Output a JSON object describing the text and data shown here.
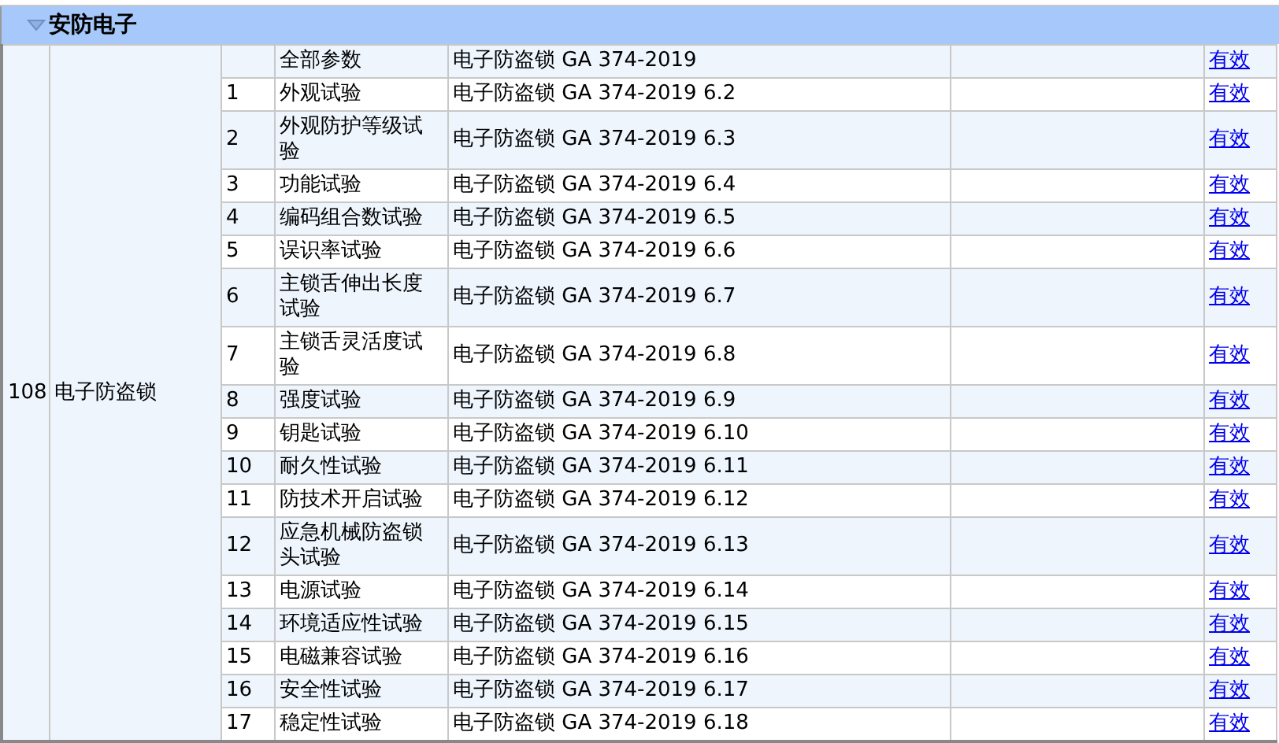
{
  "group": {
    "title": "安防电子",
    "expanded": true
  },
  "product": {
    "number": "108",
    "name": "电子防盗锁"
  },
  "rows": [
    {
      "item": "全部参数",
      "standard": "电子防盗锁 GA 374-2019",
      "status": "有效"
    },
    {
      "no": "1",
      "item": "外观试验",
      "standard": "电子防盗锁 GA 374-2019 6.2",
      "status": "有效"
    },
    {
      "no": "2",
      "item": "外观防护等级试验",
      "standard": "电子防盗锁 GA 374-2019 6.3",
      "status": "有效"
    },
    {
      "no": "3",
      "item": "功能试验",
      "standard": "电子防盗锁 GA 374-2019 6.4",
      "status": "有效"
    },
    {
      "no": "4",
      "item": "编码组合数试验",
      "standard": "电子防盗锁 GA 374-2019 6.5",
      "status": "有效"
    },
    {
      "no": "5",
      "item": "误识率试验",
      "standard": "电子防盗锁 GA 374-2019 6.6",
      "status": "有效"
    },
    {
      "no": "6",
      "item": "主锁舌伸出长度试验",
      "standard": "电子防盗锁 GA 374-2019 6.7",
      "status": "有效"
    },
    {
      "no": "7",
      "item": "主锁舌灵活度试验",
      "standard": "电子防盗锁 GA 374-2019 6.8",
      "status": "有效"
    },
    {
      "no": "8",
      "item": "强度试验",
      "standard": "电子防盗锁 GA 374-2019 6.9",
      "status": "有效"
    },
    {
      "no": "9",
      "item": "钥匙试验",
      "standard": "电子防盗锁 GA 374-2019 6.10",
      "status": "有效"
    },
    {
      "no": "10",
      "item": "耐久性试验",
      "standard": "电子防盗锁 GA 374-2019 6.11",
      "status": "有效"
    },
    {
      "no": "11",
      "item": "防技术开启试验",
      "standard": "电子防盗锁 GA 374-2019 6.12",
      "status": "有效"
    },
    {
      "no": "12",
      "item": "应急机械防盗锁头试验",
      "standard": "电子防盗锁 GA 374-2019 6.13",
      "status": "有效"
    },
    {
      "no": "13",
      "item": "电源试验",
      "standard": "电子防盗锁 GA 374-2019 6.14",
      "status": "有效"
    },
    {
      "no": "14",
      "item": "环境适应性试验",
      "standard": "电子防盗锁 GA 374-2019 6.15",
      "status": "有效"
    },
    {
      "no": "15",
      "item": "电磁兼容试验",
      "standard": "电子防盗锁 GA 374-2019 6.16",
      "status": "有效"
    },
    {
      "no": "16",
      "item": "安全性试验",
      "standard": "电子防盗锁 GA 374-2019 6.17",
      "status": "有效"
    },
    {
      "no": "17",
      "item": "稳定性试验",
      "standard": "电子防盗锁 GA 374-2019 6.18",
      "status": "有效"
    }
  ]
}
